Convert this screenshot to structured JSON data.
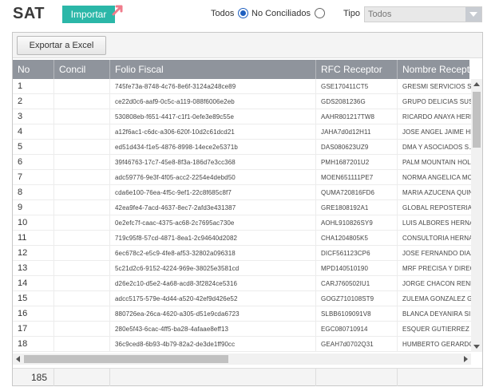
{
  "header": {
    "title": "SAT",
    "import_label": "Importar",
    "filter": {
      "todos_label": "Todos",
      "no_conciliados_label": "No Conciliados",
      "selected": "todos"
    },
    "tipo_label": "Tipo",
    "tipo_value": "Todos"
  },
  "toolbar": {
    "export_label": "Exportar a Excel"
  },
  "grid": {
    "columns": [
      "No",
      "Concil",
      "Folio Fiscal",
      "RFC Receptor",
      "Nombre Receptor"
    ],
    "rows": [
      {
        "no": "1",
        "concil": "",
        "folio": "745fe73a-8748-4c76-8e6f-3124a248ce89",
        "rfc": "GSE170411CT5",
        "nombre": "GRESMI SERVICIOS S.A."
      },
      {
        "no": "2",
        "concil": "",
        "folio": "ce22d0c6-aaf9-0c5c-a119-088f6006e2eb",
        "rfc": "GDS2081236G",
        "nombre": "GRUPO DELICIAS SUSTEN"
      },
      {
        "no": "3",
        "concil": "",
        "folio": "530808eb-f651-4417-c1f1-0efe3e89c55e",
        "rfc": "AAHR801217TW8",
        "nombre": "RICARDO ANAYA HERNANDEZ"
      },
      {
        "no": "4",
        "concil": "",
        "folio": "a12f6ac1-c6dc-a306-620f-10d2c61dcd21",
        "rfc": "JAHA7d0d12H11",
        "nombre": "JOSE ANGEL JAIME HERRERA"
      },
      {
        "no": "5",
        "concil": "",
        "folio": "ed51d434-f1e5-4876-8998-14ece2e5371b",
        "rfc": "DAS080623UZ9",
        "nombre": "DMA Y ASOCIADOS S.A."
      },
      {
        "no": "6",
        "concil": "",
        "folio": "39f46763-17c7-45e8-8f3a-186d7e3cc368",
        "rfc": "PMH1687201U2",
        "nombre": "PALM MOUNTAIN HOLDINGS"
      },
      {
        "no": "7",
        "concil": "",
        "folio": "adc59776-9e3f-4f05-acc2-2254e4debd50",
        "rfc": "MOEN651111PE7",
        "nombre": "NORMA ANGELICA MORALES"
      },
      {
        "no": "8",
        "concil": "",
        "folio": "cda6e100-76ea-4f5c-9ef1-22c8f685c8f7",
        "rfc": "QUMA720816FD6",
        "nombre": "MARIA AZUCENA QUINTERO"
      },
      {
        "no": "9",
        "concil": "",
        "folio": "42ea9fe4-7acd-4637-8ec7-2afd3e431387",
        "rfc": "GRE1808192A1",
        "nombre": "GLOBAL REPOSTERIA"
      },
      {
        "no": "10",
        "concil": "",
        "folio": "0e2efc7f-caac-4375-ac68-2c7695ac730e",
        "rfc": "AOHL910826SY9",
        "nombre": "LUIS ALBORES HERNANDEZ"
      },
      {
        "no": "11",
        "concil": "",
        "folio": "719c95f8-57cd-4871-8ea1-2c94640d2082",
        "rfc": "CHA1204805K5",
        "nombre": "CONSULTORIA HERNANDEZ"
      },
      {
        "no": "12",
        "concil": "",
        "folio": "6ec678c2-e5c9-4fe8-af53-32802a096318",
        "rfc": "DICF561123CP6",
        "nombre": "JOSE FERNANDO DIAZ"
      },
      {
        "no": "13",
        "concil": "",
        "folio": "5c21d2c6-9152-4224-969e-38025e3581cd",
        "rfc": "MPD140510190",
        "nombre": "MRF PRECISA Y DIRECTA"
      },
      {
        "no": "14",
        "concil": "",
        "folio": "d26e2c10-d5e2-4a68-acd8-3f2824ce5316",
        "rfc": "CARJ760502IU1",
        "nombre": "JORGE CHACON RENDON"
      },
      {
        "no": "15",
        "concil": "",
        "folio": "adcc5175-579e-4d44-a520-42ef9d426e52",
        "rfc": "GOGZ710108ST9",
        "nombre": "ZULEMA GONZALEZ GARCIA"
      },
      {
        "no": "16",
        "concil": "",
        "folio": "880726ea-26ca-4620-a305-d51e9cda6723",
        "rfc": "SLBB6109091V8",
        "nombre": "BLANCA DEYANIRA SILVA"
      },
      {
        "no": "17",
        "concil": "",
        "folio": "280e5f43-6cac-4ff5-ba28-4afaae8eff13",
        "rfc": "EGC080710914",
        "nombre": "ESQUER GUTIERREZ C."
      },
      {
        "no": "18",
        "concil": "",
        "folio": "36c9ced8-6b93-4b79-82a2-de3de1ff90cc",
        "rfc": "GEAH7d0702Q31",
        "nombre": "HUMBERTO GERARDO"
      }
    ]
  },
  "footer": {
    "count": "185"
  },
  "colors": {
    "accent": "#2bb7a8",
    "header_bg": "#8f949c",
    "radio_selected": "#1e5fbf"
  }
}
